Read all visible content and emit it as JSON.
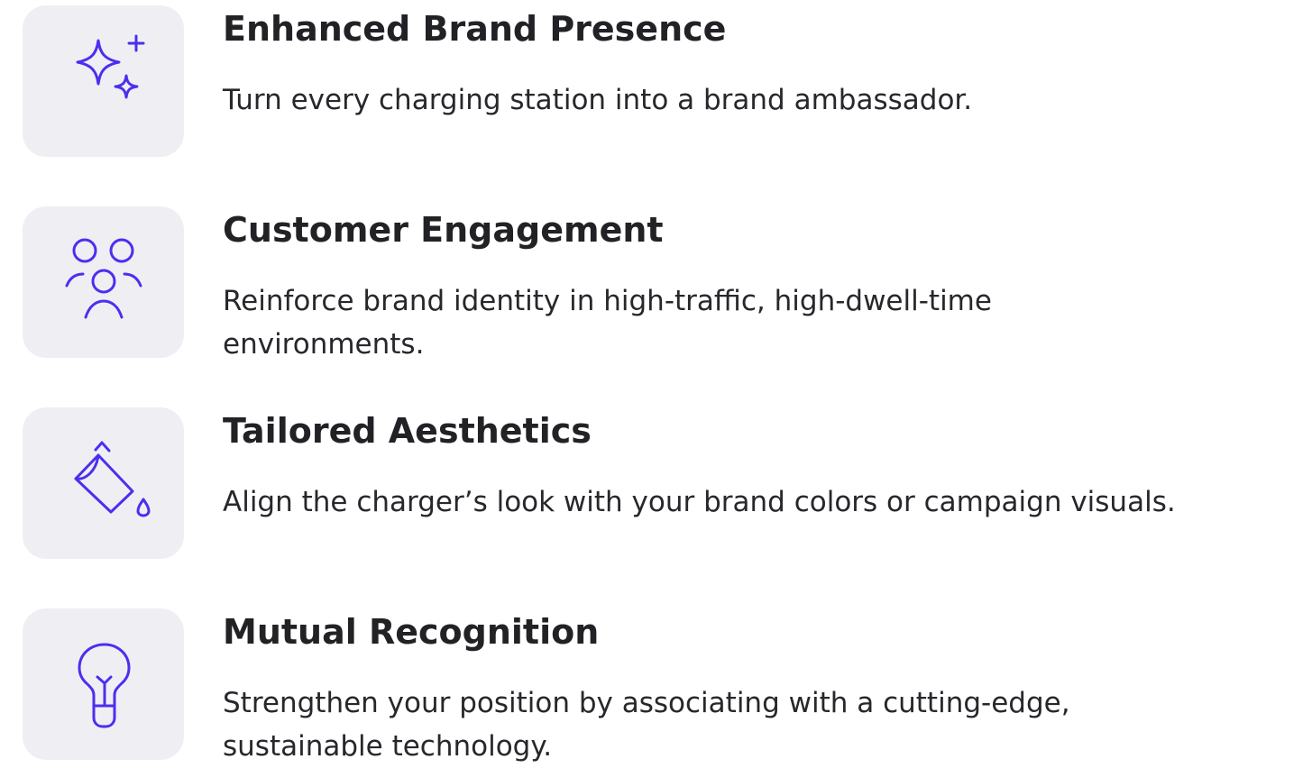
{
  "colors": {
    "accent": "#4b2ff0",
    "tile_background": "#efeff3",
    "heading": "#222226",
    "body_text": "#27272c"
  },
  "features": [
    {
      "icon": "sparkles-icon",
      "title": "Enhanced Brand Presence",
      "description": "Turn every charging station into a brand ambassador."
    },
    {
      "icon": "users-group-icon",
      "title": "Customer Engagement",
      "description": "Reinforce brand identity in high-traffic, high-dwell-time environments."
    },
    {
      "icon": "paint-bucket-icon",
      "title": "Tailored Aesthetics",
      "description": "Align the charger’s look with your brand colors or campaign visuals."
    },
    {
      "icon": "lightbulb-icon",
      "title": "Mutual Recognition",
      "description": "Strengthen your position by associating with a cutting-edge, sustainable technology."
    }
  ]
}
